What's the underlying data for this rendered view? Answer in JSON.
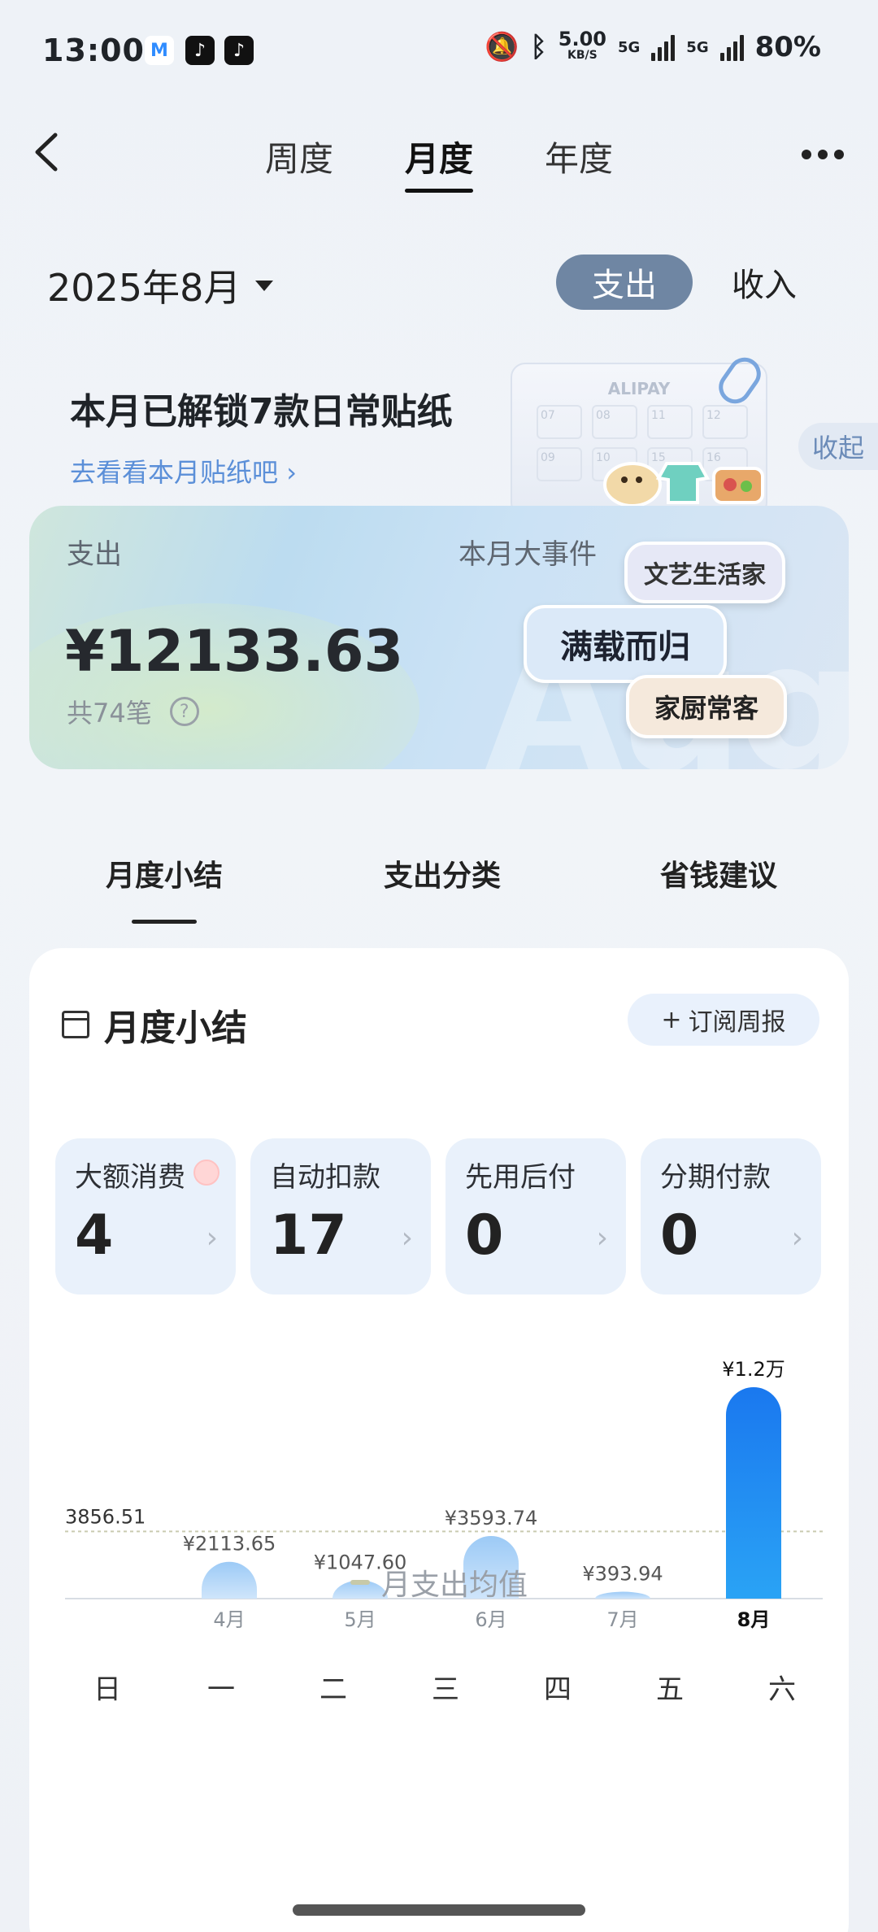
{
  "status_bar": {
    "time": "13:00",
    "net_speed": "5.00",
    "net_unit": "KB/S",
    "sig1_label": "5G",
    "sig2_label": "5G",
    "battery": "80%"
  },
  "nav": {
    "tabs": [
      "周度",
      "月度",
      "年度"
    ],
    "active_tab": "月度"
  },
  "period": {
    "month_label": "2025年8月",
    "segment_spend": "支出",
    "segment_income": "收入",
    "active_segment": "支出"
  },
  "sticker_banner": {
    "title": "本月已解锁7款日常贴纸",
    "link": "去看看本月贴纸吧",
    "collapse": "收起",
    "album_brand": "ALIPAY",
    "album_cells": [
      "07",
      "08",
      "11",
      "12",
      "09",
      "10",
      "15",
      "16"
    ]
  },
  "spend_card": {
    "label": "支出",
    "amount": "¥12133.63",
    "count": "共74笔",
    "help_icon_text": "?",
    "events_label": "本月大事件",
    "badges": [
      "文艺生活家",
      "满载而归",
      "家厨常客"
    ],
    "bg_letters": "Aug"
  },
  "section_tabs": {
    "items": [
      "月度小结",
      "支出分类",
      "省钱建议"
    ],
    "active": "月度小结"
  },
  "summary": {
    "title": "月度小结",
    "subscribe": "订阅周报",
    "subscribe_plus": "+",
    "stats": [
      {
        "name": "大额消费",
        "value": "4"
      },
      {
        "name": "自动扣款",
        "value": "17"
      },
      {
        "name": "先用后付",
        "value": "0"
      },
      {
        "name": "分期付款",
        "value": "0"
      }
    ],
    "legend": "月支出均值"
  },
  "chart_data": {
    "type": "bar",
    "categories": [
      "4月",
      "5月",
      "6月",
      "7月",
      "8月"
    ],
    "values": [
      2113.65,
      1047.6,
      3593.74,
      393.94,
      12133.63
    ],
    "value_labels": [
      "¥2113.65",
      "¥1047.60",
      "¥3593.74",
      "¥393.94",
      "¥1.2万"
    ],
    "average": 3856.51,
    "average_label": "3856.51",
    "highlight_category": "8月",
    "ylim": [
      0,
      12133.63
    ],
    "colors": {
      "normal": "#a9d0f6",
      "highlight": "#1c7ff0",
      "avg_line": "#c9cbb0"
    }
  },
  "calendar": {
    "weekdays": [
      "日",
      "一",
      "二",
      "三",
      "四",
      "五",
      "六"
    ]
  }
}
